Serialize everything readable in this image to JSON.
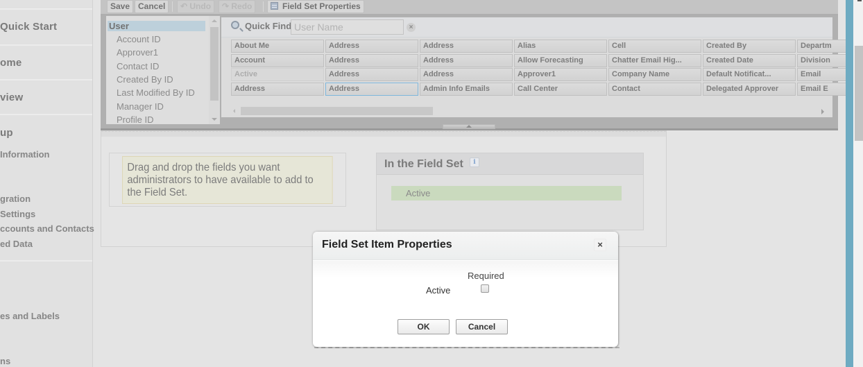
{
  "sidebar": {
    "items": [
      {
        "label": "Quick Start"
      },
      {
        "label": "ome"
      },
      {
        "label": "view"
      },
      {
        "label": "up"
      }
    ],
    "subitems": [
      {
        "label": " Information"
      },
      {
        "label": "gration"
      },
      {
        "label": "Settings"
      },
      {
        "label": "ccounts and Contacts"
      },
      {
        "label": "ed Data"
      },
      {
        "label": "es and Labels"
      },
      {
        "label": "ns"
      }
    ]
  },
  "toolbar": {
    "save_label": "Save",
    "cancel_label": "Cancel",
    "undo_label": "Undo",
    "redo_label": "Redo",
    "properties_label": "Field Set Properties"
  },
  "object_list": {
    "selected": "User",
    "items": [
      "Account ID",
      "Approver1",
      "Contact ID",
      "Created By ID",
      "Last Modified By ID",
      "Manager ID",
      "Profile ID"
    ]
  },
  "quick_find": {
    "label": "Quick Find",
    "placeholder": "User Name",
    "clear_icon": "×"
  },
  "fields": {
    "columns": [
      [
        "About Me",
        "Account",
        "Active",
        "Address"
      ],
      [
        "Address",
        "Address",
        "Address",
        "Address"
      ],
      [
        "Address",
        "Address",
        "Address",
        "Admin Info Emails"
      ],
      [
        "Alias",
        "Allow Forecasting",
        "Approver1",
        "Call Center"
      ],
      [
        "Cell",
        "Chatter Email Hig...",
        "Company Name",
        "Contact"
      ],
      [
        "Created By",
        "Created Date",
        "Default Notificat...",
        "Delegated Approver"
      ],
      [
        "Departm",
        "Division",
        "Email",
        "Email E"
      ]
    ],
    "used_field": "Active",
    "focused_field": "Address"
  },
  "help_text": "Drag and drop the fields you want administrators to have available to add to the Field Set.",
  "field_set": {
    "title": "In the Field Set",
    "info_icon": "i",
    "items": [
      "Active"
    ]
  },
  "dialog": {
    "title": "Field Set Item Properties",
    "close_icon": "×",
    "column_header": "Required",
    "row_label": "Active",
    "required_checked": false,
    "ok_label": "OK",
    "cancel_label": "Cancel"
  },
  "colors": {
    "accent_blue_bar": "#6eabc2",
    "field_set_item": "#cadabe",
    "selected_object": "#bdd0db",
    "help_box": "#e6e6d7"
  }
}
